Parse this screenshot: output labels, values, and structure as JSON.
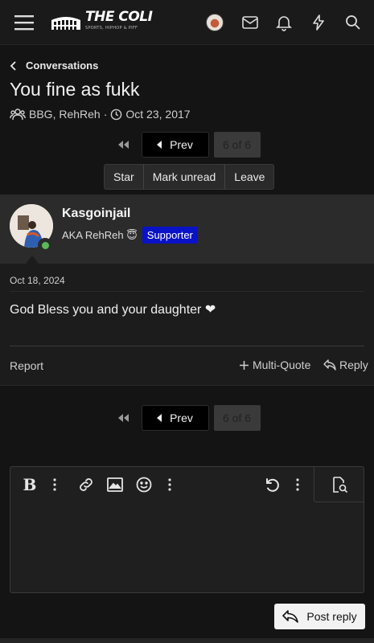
{
  "topbar": {
    "logo_brand": "THE COLI",
    "logo_tagline": "SPORTS, HIPHOP & PIFF"
  },
  "breadcrumb": {
    "label": "Conversations"
  },
  "conversation": {
    "title": "You fine as fukk",
    "participants": "BBG, RehReh",
    "date": "Oct 23, 2017"
  },
  "pagination": {
    "prev_label": "Prev",
    "current": "6 of 6"
  },
  "actions": {
    "star": "Star",
    "mark_unread": "Mark unread",
    "leave": "Leave"
  },
  "message": {
    "username": "Kasgoinjail",
    "user_title": "AKA RehReh 😇",
    "badge": "Supporter",
    "date": "Oct 18, 2024",
    "text": "God Bless you and your daughter ❤",
    "report": "Report",
    "multiquote": "Multi-Quote",
    "reply": "Reply"
  },
  "editor": {
    "post_label": "Post reply"
  },
  "colors": {
    "background": "#141414",
    "badge": "#0a12c8",
    "online": "#5cb85c"
  }
}
